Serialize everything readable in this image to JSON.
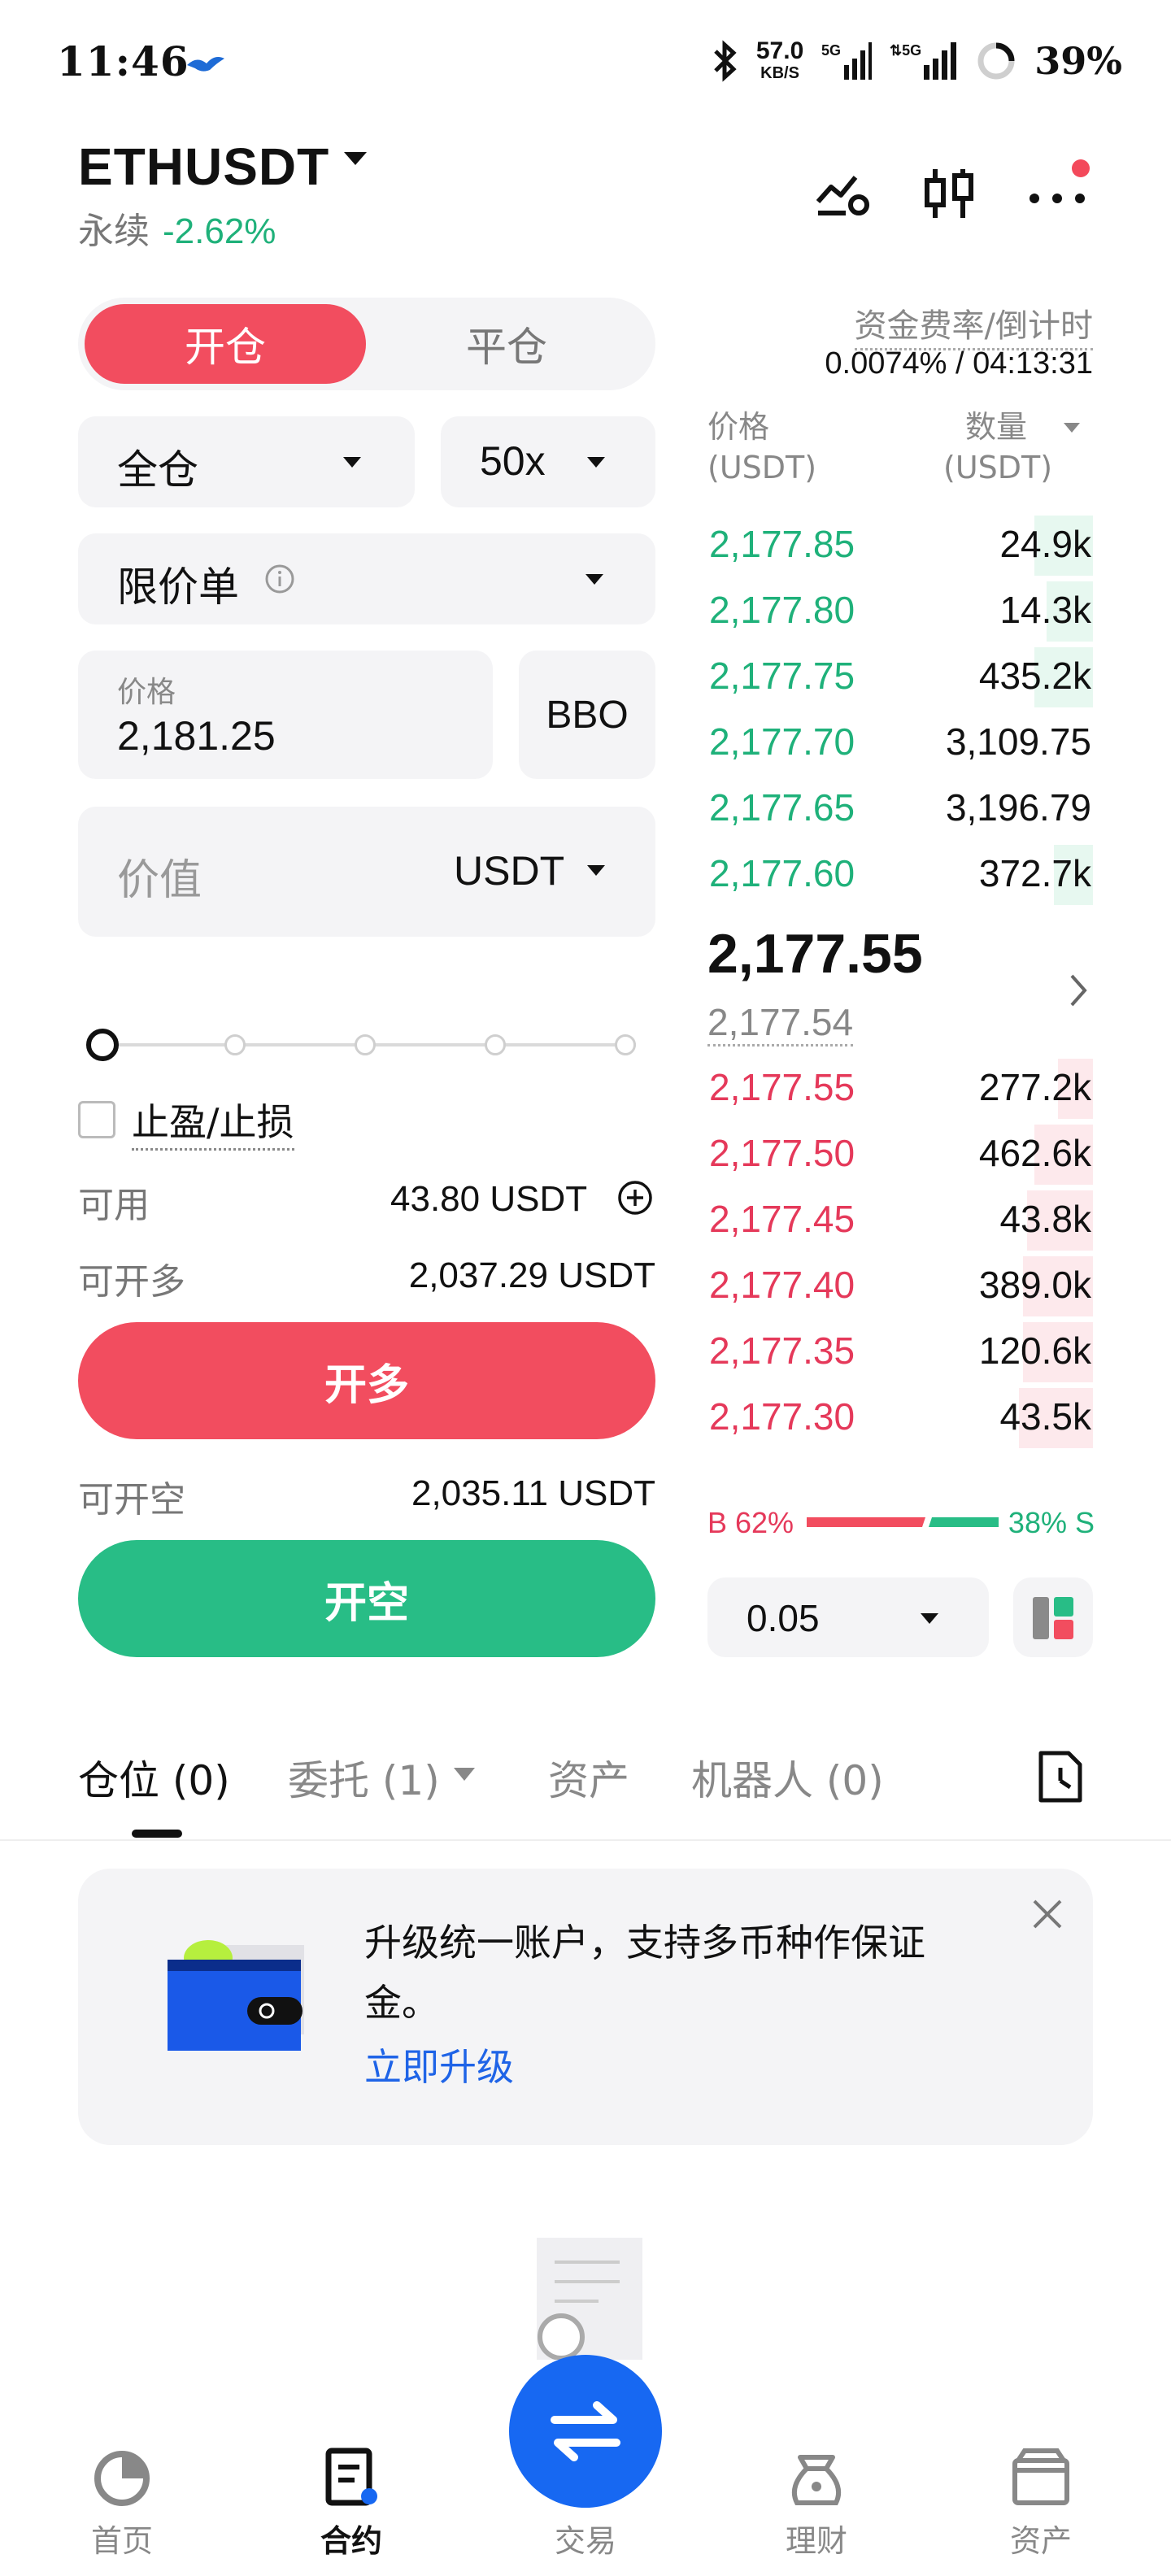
{
  "status_bar": {
    "time": "11:46",
    "net_speed_value": "57.0",
    "net_speed_unit": "KB/S",
    "signal1_label": "5G",
    "signal2_label": "5G",
    "battery": "39%"
  },
  "header": {
    "pair": "ETHUSDT",
    "contract_type": "永续",
    "change": "-2.62%"
  },
  "funding": {
    "label": "资金费率/倒计时",
    "value": "0.0074% / 04:13:31"
  },
  "order_form": {
    "tab_open": "开仓",
    "tab_close": "平仓",
    "margin_mode": "全仓",
    "leverage": "50x",
    "order_type": "限价单",
    "price_label": "价格",
    "price_value": "2,181.25",
    "bbo_label": "BBO",
    "value_placeholder": "价值",
    "value_unit": "USDT",
    "slider_level": 0,
    "tp_sl_label": "止盈/止损",
    "available_label": "可用",
    "available_value": "43.80  USDT",
    "max_long_label": "可开多",
    "max_long_value": "2,037.29 USDT",
    "long_button": "开多",
    "max_short_label": "可开空",
    "max_short_value": "2,035.11 USDT",
    "short_button": "开空"
  },
  "order_book": {
    "price_header": "价格",
    "price_unit": "(USDT)",
    "qty_header": "数量",
    "qty_unit": "(USDT)",
    "asks": [
      {
        "price": "2,177.85",
        "qty": "24.9k",
        "depth": 0.15
      },
      {
        "price": "2,177.80",
        "qty": "14.3k",
        "depth": 0.12
      },
      {
        "price": "2,177.75",
        "qty": "435.2k",
        "depth": 0.15
      },
      {
        "price": "2,177.70",
        "qty": "3,109.75",
        "depth": 0.0
      },
      {
        "price": "2,177.65",
        "qty": "3,196.79",
        "depth": 0.0
      },
      {
        "price": "2,177.60",
        "qty": "372.7k",
        "depth": 0.1
      }
    ],
    "last_price": "2,177.55",
    "mark_price": "2,177.54",
    "bids": [
      {
        "price": "2,177.55",
        "qty": "277.2k",
        "depth": 0.09
      },
      {
        "price": "2,177.50",
        "qty": "462.6k",
        "depth": 0.15
      },
      {
        "price": "2,177.45",
        "qty": "43.8k",
        "depth": 0.17
      },
      {
        "price": "2,177.40",
        "qty": "389.0k",
        "depth": 0.18
      },
      {
        "price": "2,177.35",
        "qty": "120.6k",
        "depth": 0.18
      },
      {
        "price": "2,177.30",
        "qty": "43.5k",
        "depth": 0.19
      }
    ],
    "buy_ratio": "B 62%",
    "sell_ratio": "38% S",
    "buy_fraction": 0.62,
    "step": "0.05"
  },
  "tabs": {
    "positions": "仓位 (0)",
    "orders": "委托 (1)",
    "assets": "资产",
    "bots": "机器人 (0)"
  },
  "banner": {
    "text": "升级统一账户，支持多币种作保证金。",
    "link": "立即升级"
  },
  "nav": {
    "home": "首页",
    "contracts": "合约",
    "trade": "交易",
    "earn": "理财",
    "assets": "资产"
  },
  "colors": {
    "red": "#f24d5f",
    "green": "#28bd86",
    "blue": "#1768f2"
  }
}
